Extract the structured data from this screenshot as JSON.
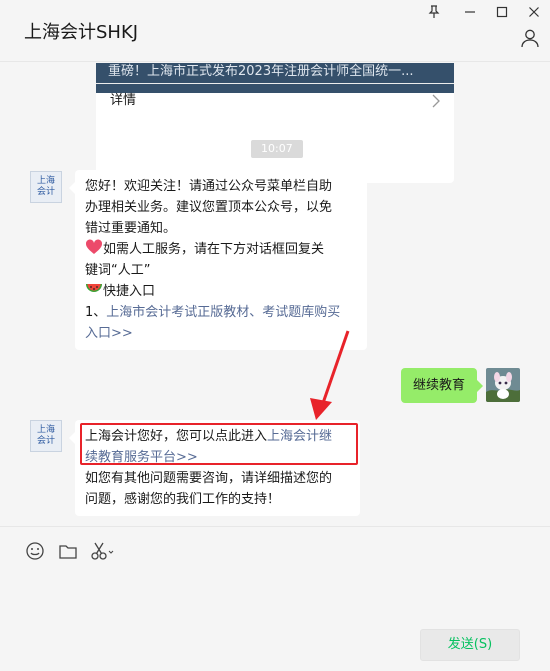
{
  "window": {
    "title": "上海会计SHKJ",
    "controls": [
      "pin-icon",
      "minimize-icon",
      "maximize-icon",
      "close-icon"
    ]
  },
  "card": {
    "banner_text": "重磅！上海市正式发布2023年注册会计师全国统一...",
    "detail_label": "详情"
  },
  "timestamp": "10:07",
  "messages": {
    "welcome": {
      "avatar_text_top": "上海",
      "avatar_text_bottom": "会计",
      "line1": "您好！欢迎关注！请通过公众号菜单栏自助",
      "line2": "办理相关业务。建议您置顶本公众号，以免",
      "line3": "错过重要通知。",
      "line4": "如需人工服务，请在下方对话框回复关",
      "line5": "键词“人工”",
      "line6": "快捷入口",
      "link_prefix": "1、",
      "link_line1": "上海市会计考试正版教材、考试题库购买",
      "link_line2": "入口>>"
    },
    "user": {
      "text": "继续教育"
    },
    "reply": {
      "avatar_text_top": "上海",
      "avatar_text_bottom": "会计",
      "line1_plain": "上海会计您好，您可以点此进入",
      "line1_link": "上海会计继",
      "line2_link": "续教育服务平台>>",
      "line3": "如您有其他问题需要咨询，请详细描述您的",
      "line4": "问题，感谢您的我们工作的支持！"
    }
  },
  "toolbar": {
    "icons": [
      "emoji-icon",
      "folder-icon",
      "scissors-icon"
    ],
    "send_label": "发送(S)"
  },
  "colors": {
    "my_bubble": "#95ec69",
    "link": "#576b95",
    "highlight": "#e8232a",
    "send_text": "#07c160"
  }
}
